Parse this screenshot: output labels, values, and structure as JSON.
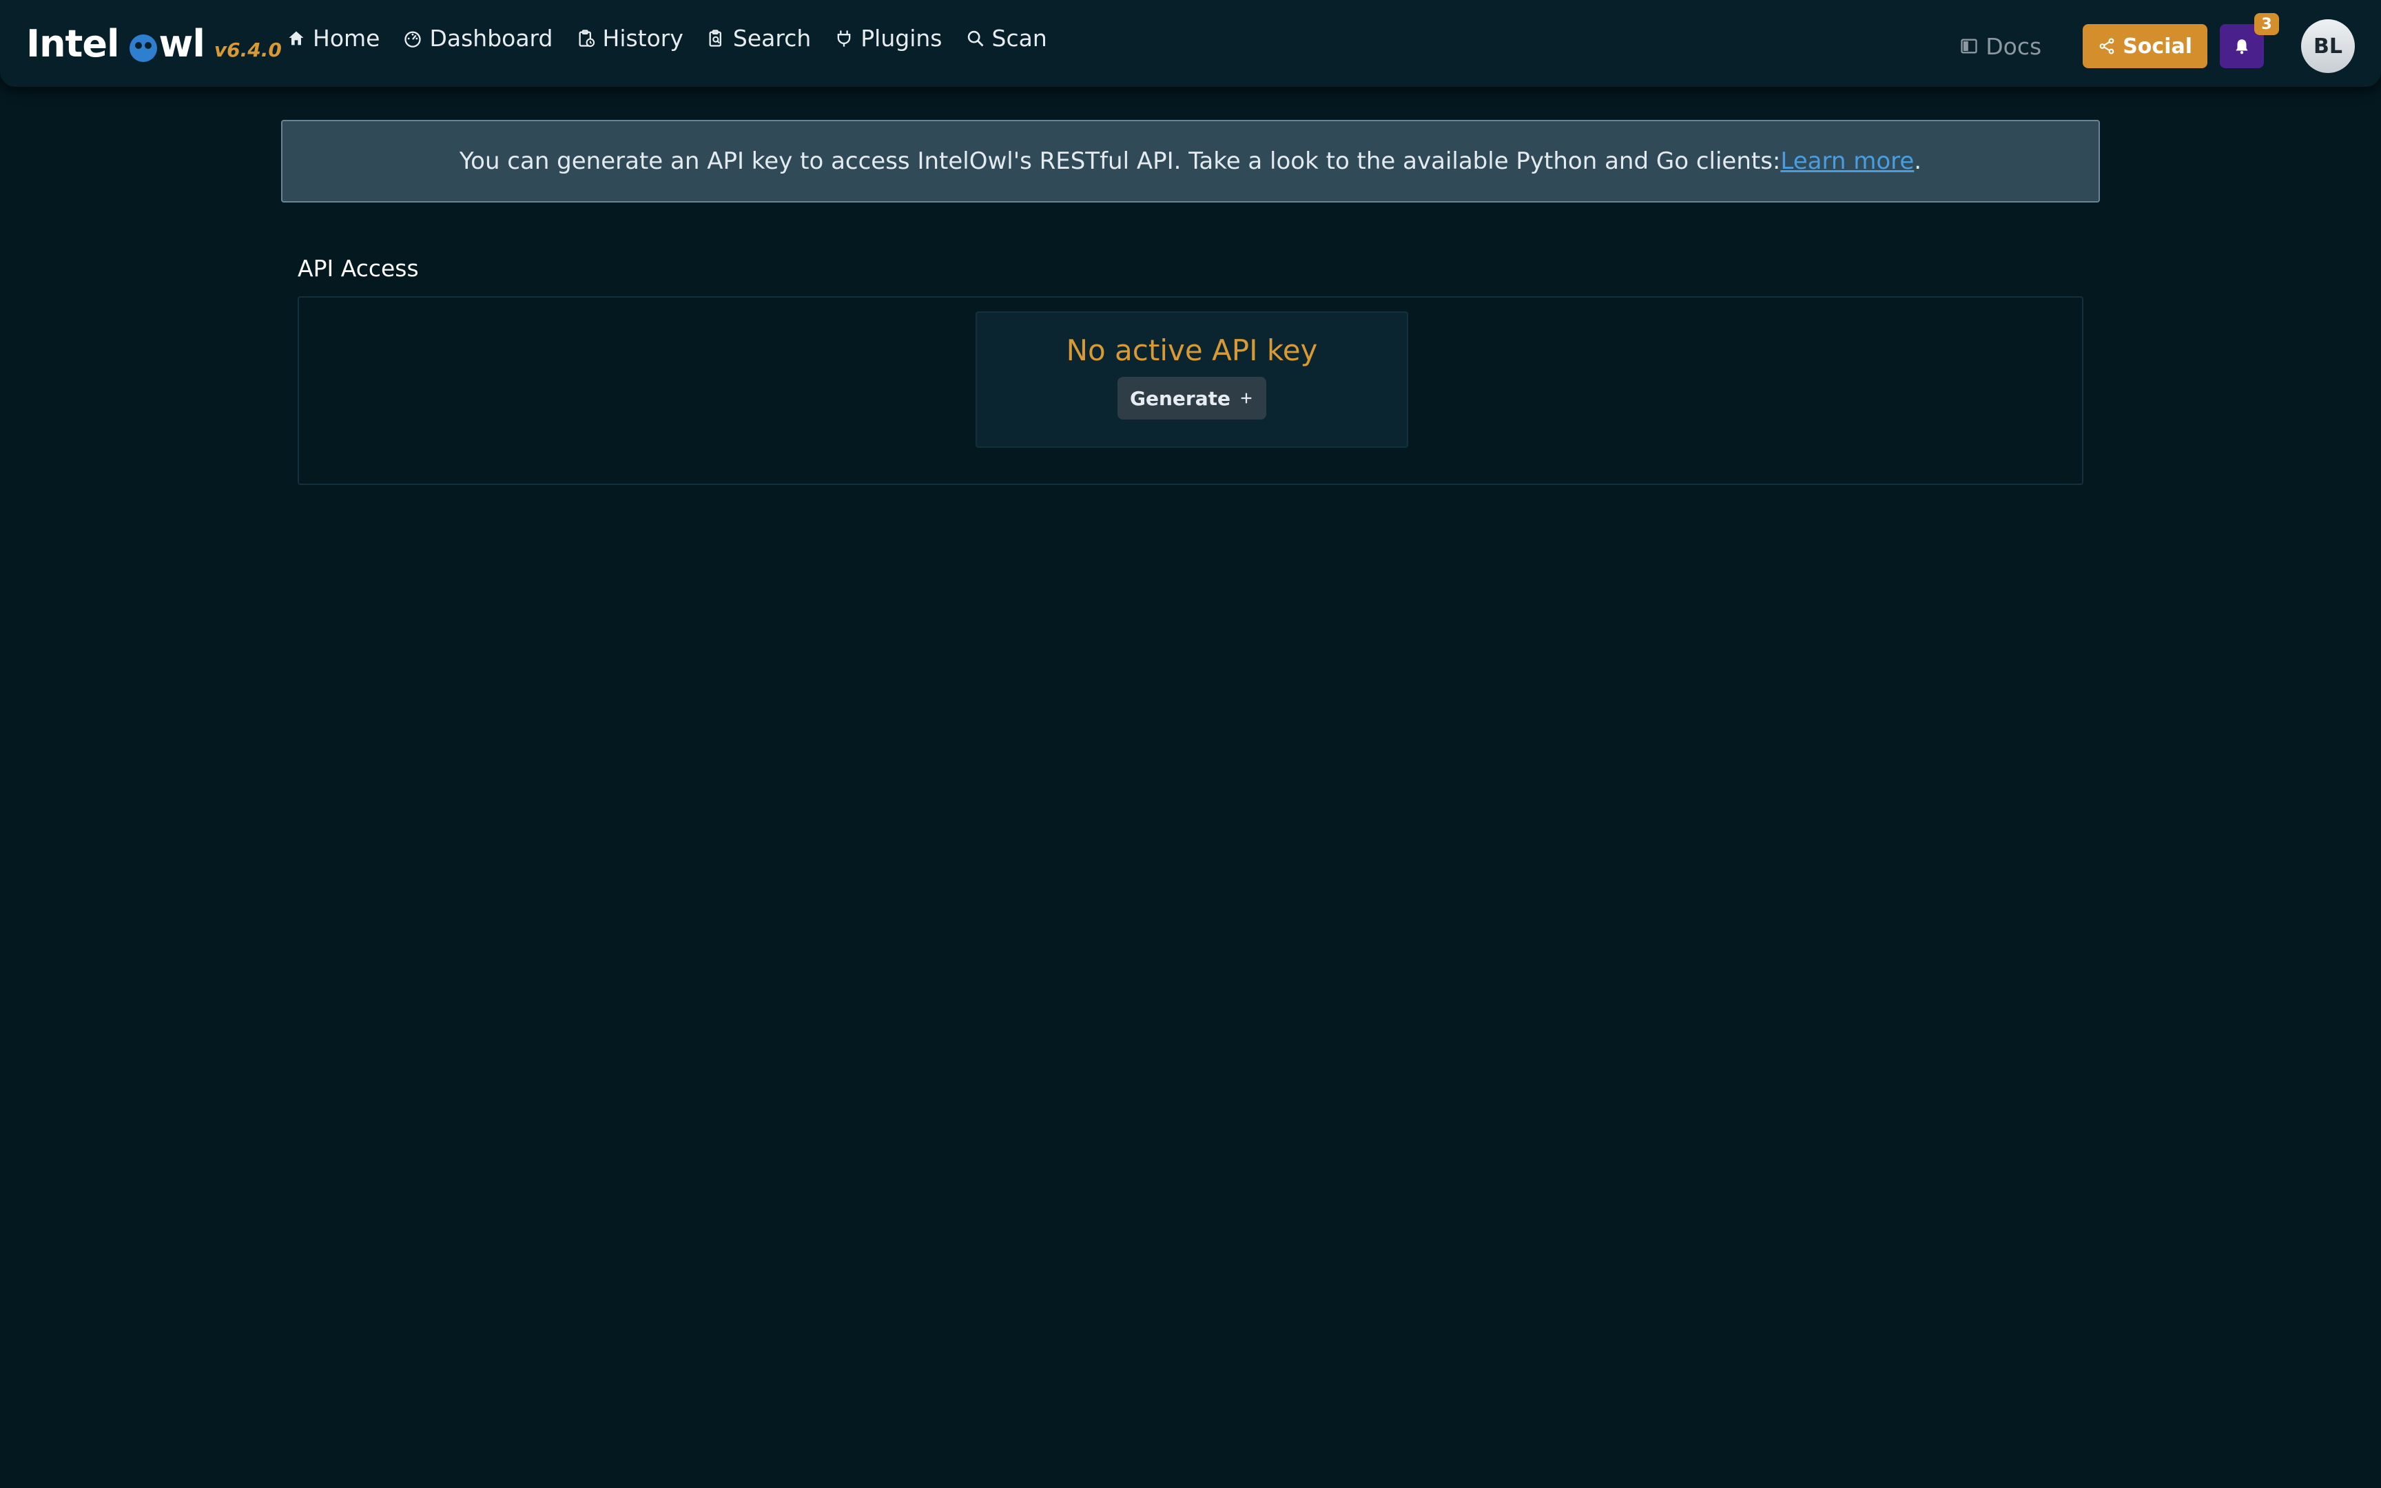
{
  "brand": {
    "name_prefix": "Intel",
    "name_suffix": "wl",
    "version": "v6.4.0"
  },
  "nav": {
    "items": [
      {
        "label": "Home",
        "icon": "home-icon"
      },
      {
        "label": "Dashboard",
        "icon": "dashboard-icon"
      },
      {
        "label": "History",
        "icon": "history-icon"
      },
      {
        "label": "Search",
        "icon": "search-doc-icon"
      },
      {
        "label": "Plugins",
        "icon": "plug-icon"
      },
      {
        "label": "Scan",
        "icon": "search-icon"
      }
    ],
    "docs_label": "Docs",
    "social_label": "Social",
    "notification_count": "3",
    "avatar_initials": "BL"
  },
  "banner": {
    "text": "You can generate an API key to access IntelOwl's RESTful API. Take a look to the available Python and Go clients:",
    "link_label": "Learn more",
    "suffix": "."
  },
  "api_access": {
    "title": "API Access",
    "status": "No active API key",
    "generate_label": "Generate"
  },
  "colors": {
    "background": "#041820",
    "navbar": "#071f28",
    "accent": "#d89a34",
    "social": "#d58e2c",
    "notification": "#4a208c",
    "link": "#4a9ee0"
  }
}
